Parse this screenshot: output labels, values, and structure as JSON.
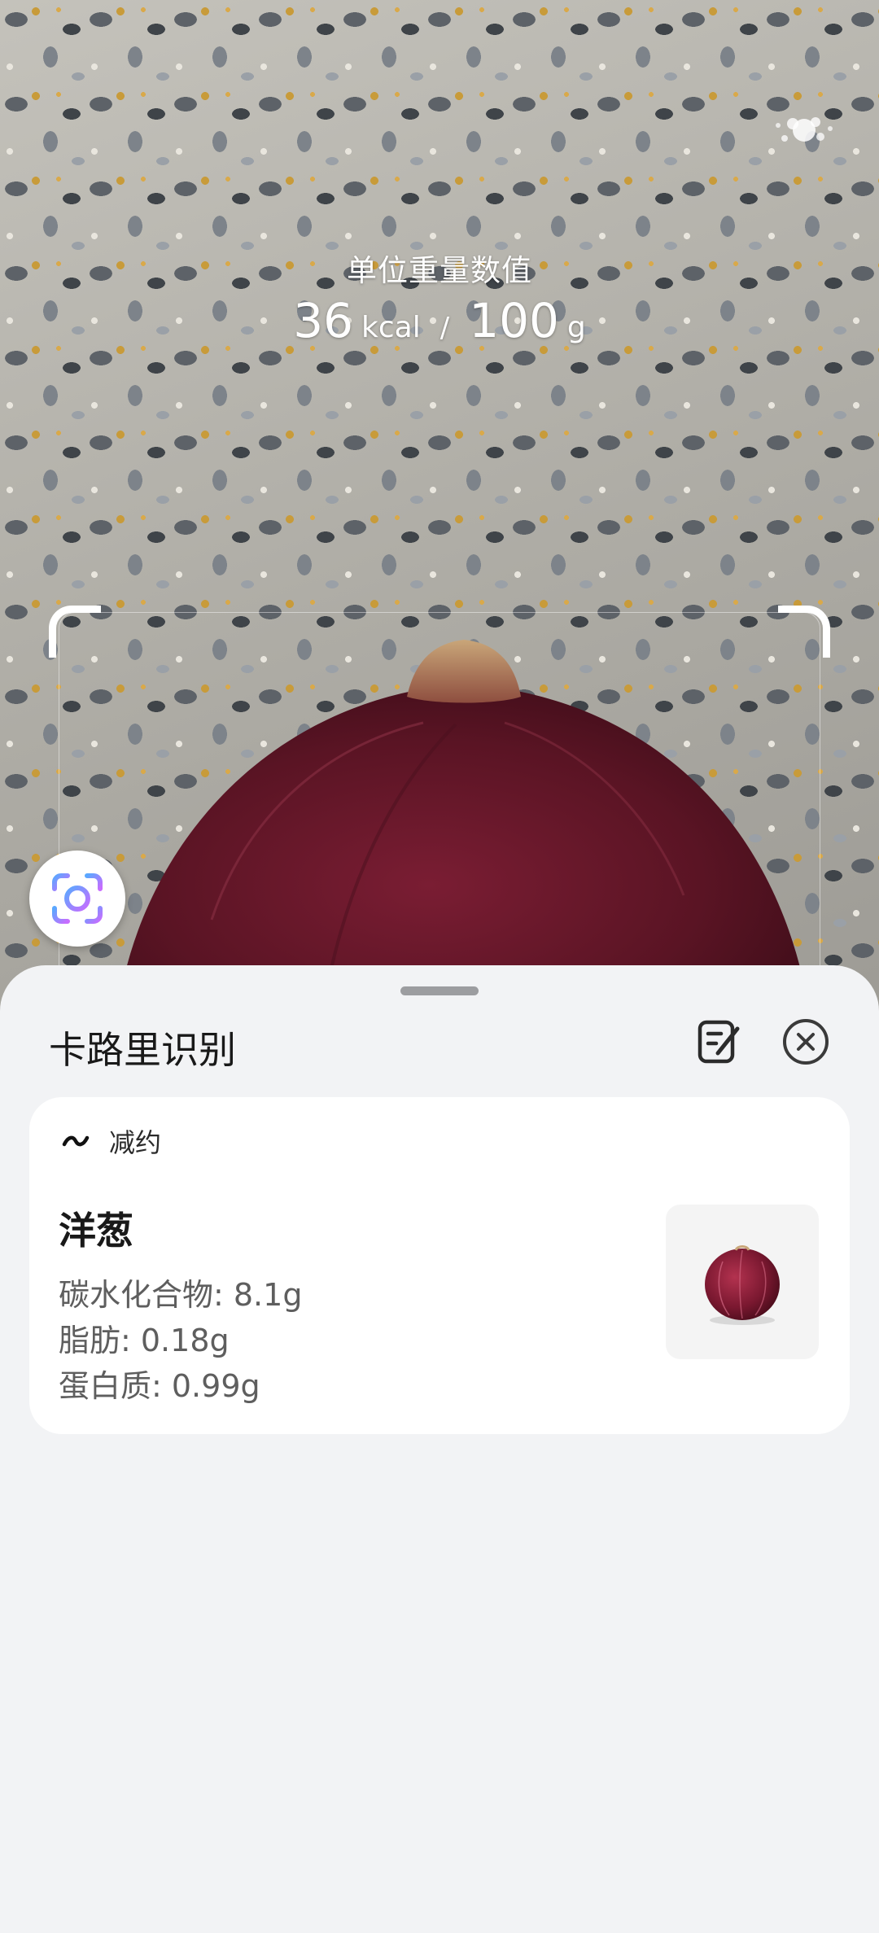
{
  "unit_info": {
    "title": "单位重量数值",
    "calories_value": "36",
    "calories_unit": "kcal",
    "separator": "/",
    "weight_value": "100",
    "weight_unit": "g"
  },
  "icons": {
    "sparkle": "sparkle-icon",
    "lens": "lens-scan-icon",
    "edit": "edit-note-icon",
    "close": "close-icon",
    "tag": "tilde-icon"
  },
  "sheet": {
    "title": "卡路里识别"
  },
  "result": {
    "tag": "减约",
    "name": "洋葱",
    "nutrients": [
      {
        "label": "碳水化合物",
        "value": "8.1g",
        "text": "碳水化合物: 8.1g"
      },
      {
        "label": "脂肪",
        "value": "0.18g",
        "text": "脂肪: 0.18g"
      },
      {
        "label": "蛋白质",
        "value": "0.99g",
        "text": "蛋白质: 0.99g"
      }
    ]
  },
  "colors": {
    "sheet_background": "#f2f3f5",
    "card_background": "#ffffff",
    "onion": "#5a1424",
    "lens_gradient_start": "#5aa8ff",
    "lens_gradient_end": "#c86cff"
  }
}
